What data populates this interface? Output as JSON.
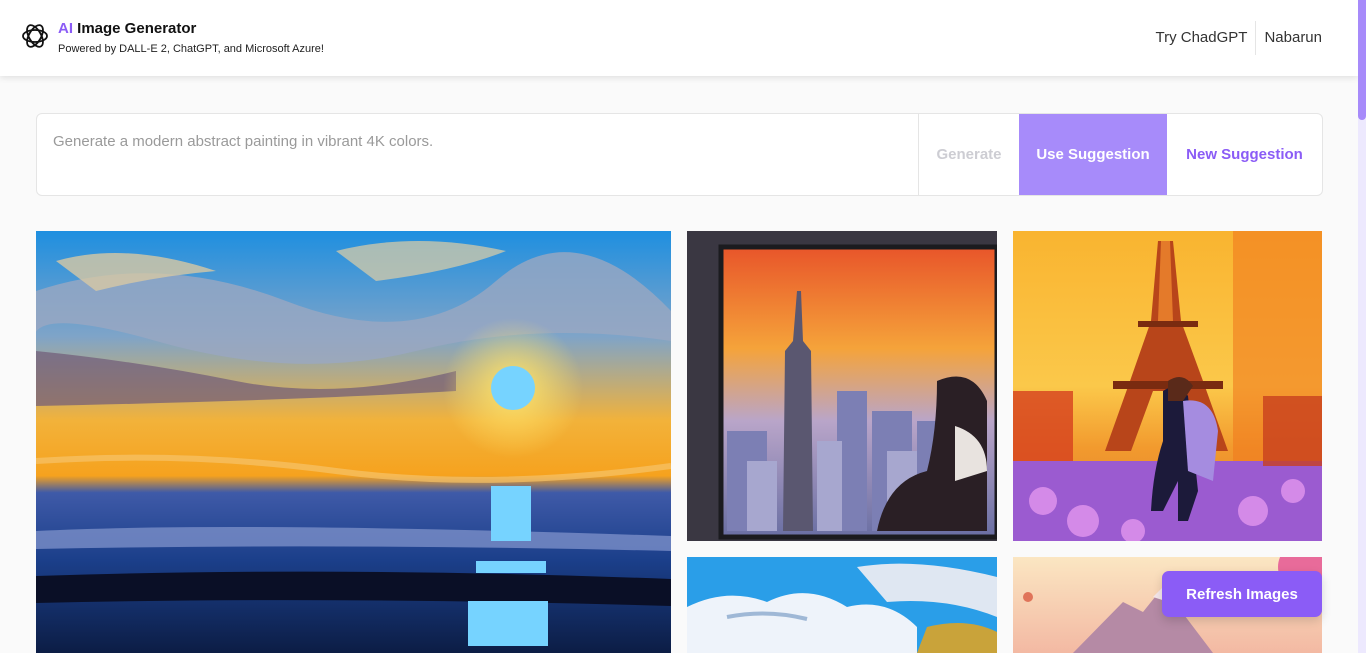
{
  "header": {
    "brand_ai": "AI",
    "brand_rest": " Image Generator",
    "subtitle": "Powered by DALL-E 2, ChatGPT, and Microsoft Azure!",
    "nav": [
      "Try ChadGPT",
      "Nabarun"
    ]
  },
  "prompt": {
    "placeholder": "Generate a modern abstract painting in vibrant 4K colors.",
    "value": ""
  },
  "buttons": {
    "generate": "Generate",
    "use_suggestion": "Use Suggestion",
    "new_suggestion": "New Suggestion",
    "refresh": "Refresh Images"
  },
  "colors": {
    "accent": "#8b5cf6",
    "accent_light": "#a78bfa",
    "disabled": "#cdcdd3"
  },
  "gallery": [
    {
      "name": "sunset-painting"
    },
    {
      "name": "new-york-window-painting"
    },
    {
      "name": "eiffel-tower-couple-painting"
    },
    {
      "name": "clouds-painting"
    },
    {
      "name": "mountain-painting"
    }
  ]
}
